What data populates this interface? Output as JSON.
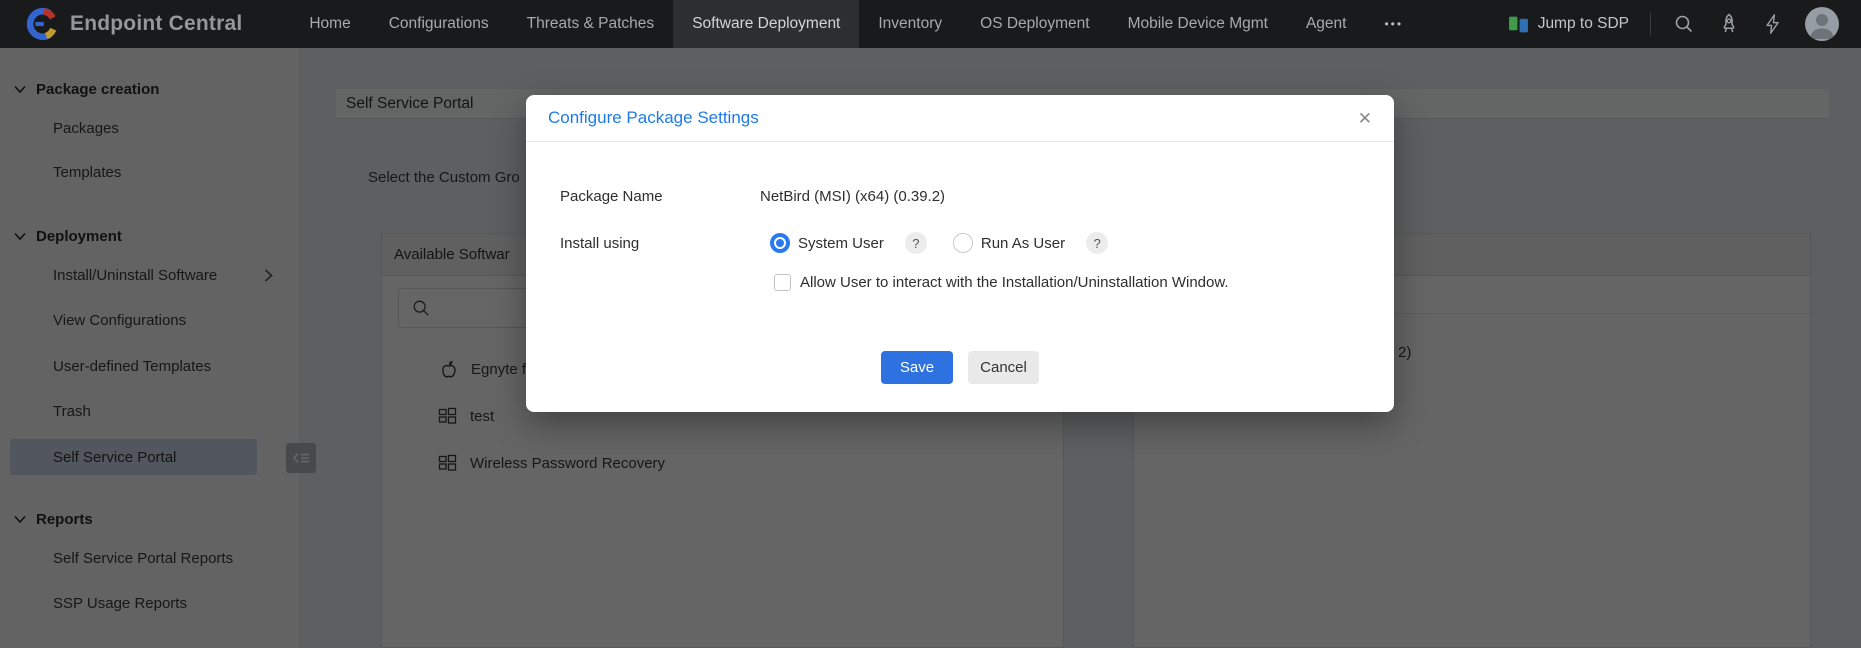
{
  "nav": {
    "brand": "Endpoint Central",
    "items": [
      "Home",
      "Configurations",
      "Threats & Patches",
      "Software Deployment",
      "Inventory",
      "OS Deployment",
      "Mobile Device Mgmt",
      "Agent"
    ],
    "active_item": "Software Deployment",
    "jump_to_sdp": "Jump to SDP"
  },
  "icons": {
    "more": "•••",
    "close": "✕",
    "help": "?"
  },
  "sidebar": {
    "sections": [
      {
        "label": "Package creation",
        "items": [
          "Packages",
          "Templates"
        ]
      },
      {
        "label": "Deployment",
        "items": [
          "Install/Uninstall Software",
          "View Configurations",
          "User-defined Templates",
          "Trash",
          "Self Service Portal"
        ]
      },
      {
        "label": "Reports",
        "items": [
          "Self Service Portal Reports",
          "SSP Usage Reports"
        ]
      }
    ],
    "active_item": "Self Service Portal"
  },
  "page": {
    "title": "Self Service Portal",
    "intro_partial": "Select the Custom Gro",
    "available_panel": {
      "header_partial": "Available Softwar",
      "items": [
        {
          "icon": "apple-icon",
          "label": "Egnyte f"
        },
        {
          "icon": "windows-icon",
          "label": "test"
        },
        {
          "icon": "windows-icon",
          "label": "Wireless Password Recovery"
        }
      ]
    },
    "selected_panel": {
      "visible_text_partial": "2)"
    }
  },
  "modal": {
    "title": "Configure Package Settings",
    "package_name_label": "Package Name",
    "package_name_value": "NetBird (MSI) (x64) (0.39.2)",
    "install_using_label": "Install using",
    "options": [
      {
        "label": "System User",
        "selected": true
      },
      {
        "label": "Run As User",
        "selected": false
      }
    ],
    "checkbox_label": "Allow User to interact with the Installation/Uninstallation Window.",
    "save_label": "Save",
    "cancel_label": "Cancel"
  },
  "colors": {
    "accent_blue": "#1e7be8",
    "save_button_blue": "#2e71e0",
    "radio_selected_blue": "#2979f0",
    "sidebar_active_bg": "#ccd7ee",
    "nav_bg": "#191a1c"
  }
}
